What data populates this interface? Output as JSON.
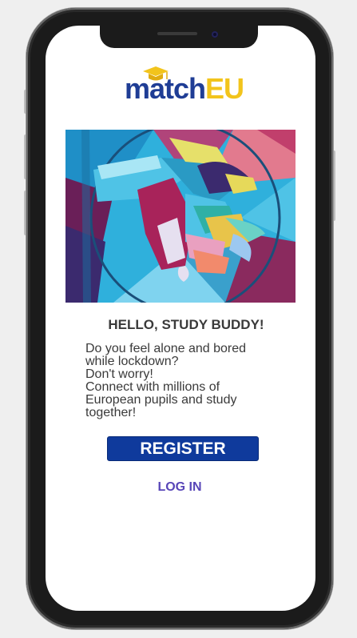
{
  "app": {
    "logo_part1": "match",
    "logo_part2": "EU",
    "brand_color_primary": "#1f3d95",
    "brand_color_accent": "#f2c41c"
  },
  "hero_image": {
    "icon": "painted-hands-mural"
  },
  "welcome": {
    "headline": "HELLO, STUDY BUDDY!",
    "body_lines": [
      "Do you feel alone and bored",
      "while lockdown?",
      "Don't worry!",
      "Connect with millions of",
      "European pupils and study",
      "together!"
    ]
  },
  "actions": {
    "register_label": "REGISTER",
    "login_label": "LOG IN",
    "register_color": "#0f3a9c",
    "login_color": "#5846b8"
  }
}
